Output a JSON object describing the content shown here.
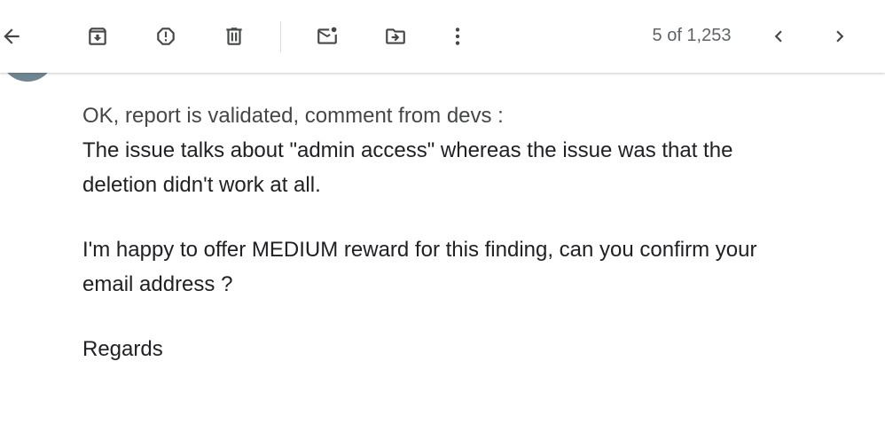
{
  "toolbar": {
    "back_icon": "arrow-left-icon",
    "archive_icon": "archive-icon",
    "spam_icon": "report-spam-icon",
    "delete_icon": "trash-icon",
    "mark_unread_icon": "mark-unread-icon",
    "move_to_icon": "move-to-folder-icon",
    "more_icon": "more-vertical-icon",
    "pagination": "5 of 1,253",
    "prev_icon": "chevron-left-icon",
    "next_icon": "chevron-right-icon"
  },
  "colors": {
    "icon": "#444746",
    "avatar": "#6f8692",
    "text": "#202124",
    "quoted_text": "#444746"
  },
  "message": {
    "line1": "OK, report is validated, comment from devs :",
    "line2": "The issue talks about \"admin access\" whereas the issue was that the",
    "line3": "deletion didn't work at all.",
    "line4": "I'm happy to offer MEDIUM reward for this finding, can you confirm your",
    "line5": "email address ?",
    "line6": "Regards"
  }
}
